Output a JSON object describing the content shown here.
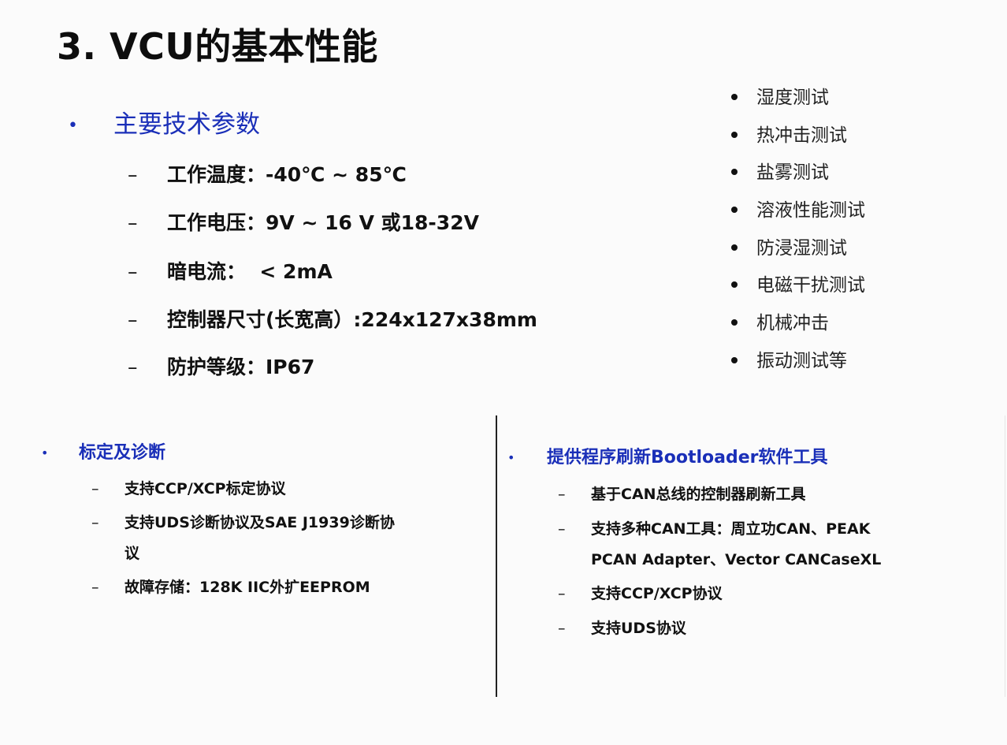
{
  "title": "3. VCU的基本性能",
  "params": {
    "heading": "主要技术参数",
    "items": [
      "工作温度：-40℃ ~ 85℃",
      "工作电压：9V ~ 16 V 或18-32V",
      "暗电流：  < 2mA",
      "控制器尺寸(长宽高）:224x127x38mm",
      "防护等级：IP67"
    ]
  },
  "tests": [
    "湿度测试",
    "热冲击测试",
    "盐雾测试",
    "溶液性能测试",
    "防浸湿测试",
    "电磁干扰测试",
    "机械冲击",
    "振动测试等"
  ],
  "calibration": {
    "heading": "标定及诊断",
    "items": [
      "支持CCP/XCP标定协议",
      "支持UDS诊断协议及SAE J1939诊断协",
      "议",
      "故障存储：128K IIC外扩EEPROM"
    ]
  },
  "bootloader": {
    "heading": "提供程序刷新Bootloader软件工具",
    "items": [
      "基于CAN总线的控制器刷新工具",
      "支持多种CAN工具：周立功CAN、PEAK",
      "PCAN Adapter、Vector CANCaseXL",
      "支持CCP/XCP协议",
      "支持UDS协议"
    ]
  },
  "symbols": {
    "bullet": "•",
    "dash": "–"
  },
  "colors": {
    "heading_blue": "#1a2fb8",
    "text": "#111111",
    "background": "#fbfbfb"
  }
}
